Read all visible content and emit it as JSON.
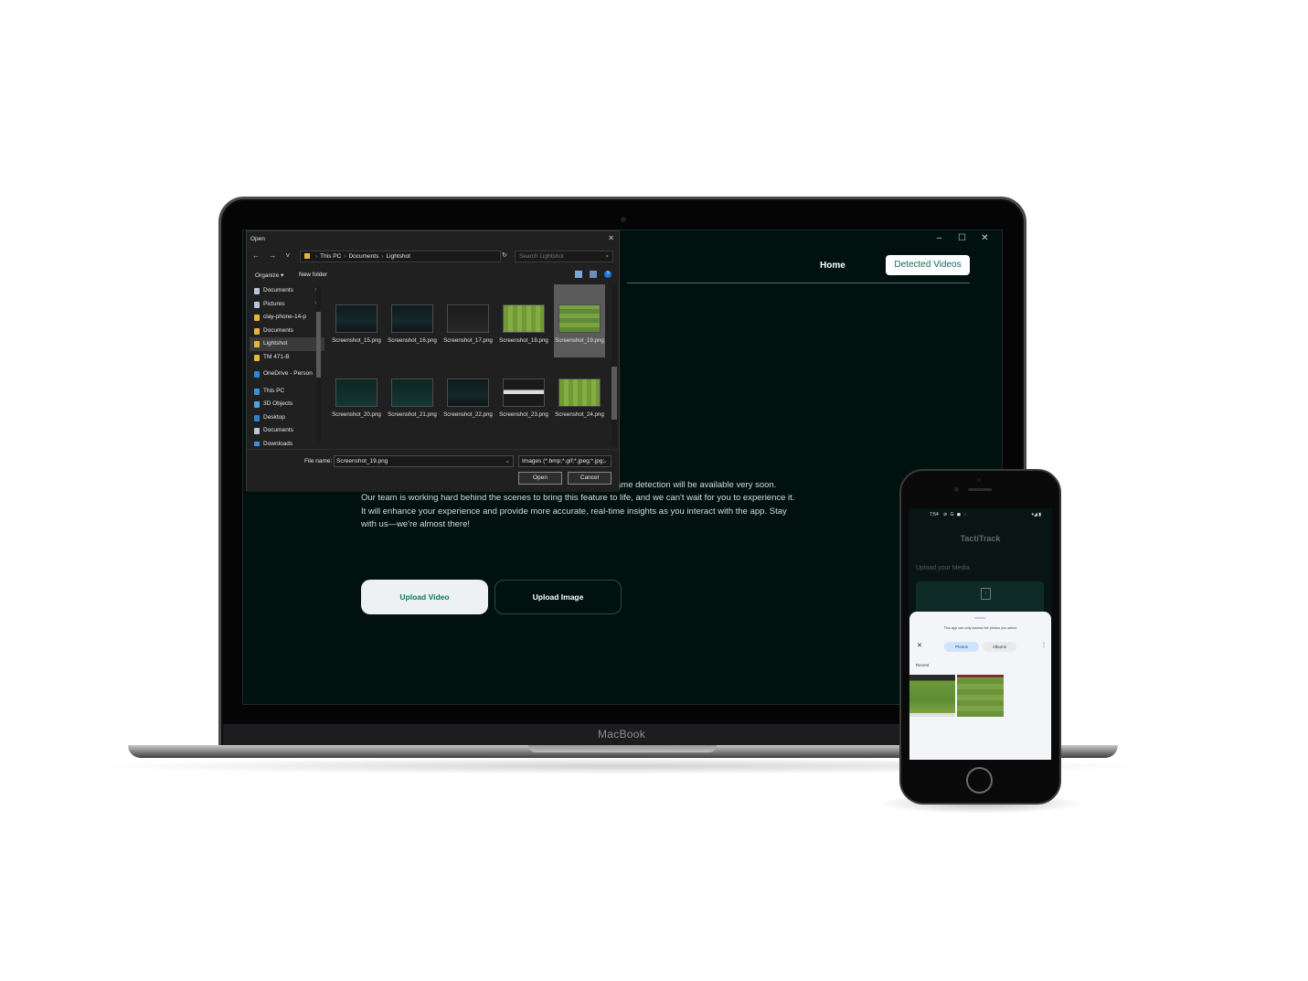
{
  "laptop": {
    "brand": "MacBook"
  },
  "app": {
    "window_controls": [
      "–",
      "☐",
      "✕"
    ],
    "nav": {
      "home": "Home",
      "detected_videos": "Detected Videos"
    },
    "message_first_line": "ame detection will be available very soon.",
    "message_body": "Our team is working hard behind the scenes to bring this feature to life, and we can't wait for you to experience it. It will enhance your experience and provide more accurate, real-time insights as you interact with the app. Stay with us—we're almost there!",
    "upload_video": "Upload Video",
    "upload_image": "Upload Image"
  },
  "dialog": {
    "title": "Open",
    "close": "✕",
    "nav_arrows": "← → ˅ ↑",
    "breadcrumb": [
      "This PC",
      "Documents",
      "Lightshot"
    ],
    "refresh": "↻",
    "search_placeholder": "Search Lightshot",
    "search_icon": "⌕",
    "organize": "Organize ▾",
    "new_folder": "New folder",
    "help": "?",
    "sidebar": [
      {
        "label": "Documents",
        "icon": "document-icon",
        "color": "#b8c6d8",
        "pinned": true
      },
      {
        "label": "Pictures",
        "icon": "picture-icon",
        "color": "#b8c6d8",
        "pinned": true
      },
      {
        "label": "clay-phone-14-p",
        "icon": "folder-icon",
        "color": "#e7b53c",
        "pinned": false
      },
      {
        "label": "Documents",
        "icon": "folder-icon",
        "color": "#e7b53c",
        "pinned": false
      },
      {
        "label": "Lightshot",
        "icon": "folder-icon",
        "color": "#e7b53c",
        "pinned": false,
        "selected": true
      },
      {
        "label": "TM 471-B",
        "icon": "folder-icon",
        "color": "#e7b53c",
        "pinned": false
      },
      {
        "label": "OneDrive - Person",
        "icon": "cloud-icon",
        "color": "#2f86d9",
        "pinned": false,
        "gap_before": true
      },
      {
        "label": "This PC",
        "icon": "computer-icon",
        "color": "#3d8fd8",
        "pinned": false,
        "gap_before": true
      },
      {
        "label": "3D Objects",
        "icon": "cube-icon",
        "color": "#4aa3e6",
        "pinned": false
      },
      {
        "label": "Desktop",
        "icon": "desktop-icon",
        "color": "#2d7fd0",
        "pinned": false
      },
      {
        "label": "Documents",
        "icon": "document-icon",
        "color": "#b8c6d8",
        "pinned": false
      },
      {
        "label": "Downloads",
        "icon": "download-icon",
        "color": "#3d8fd8",
        "pinned": false
      }
    ],
    "files": [
      {
        "name": "Screenshot_15.png",
        "thumb": "dark",
        "selected": false
      },
      {
        "name": "Screenshot_16.png",
        "thumb": "dark",
        "selected": false
      },
      {
        "name": "Screenshot_17.png",
        "thumb": "darkgrey",
        "selected": false
      },
      {
        "name": "Screenshot_18.png",
        "thumb": "pitch",
        "selected": false
      },
      {
        "name": "Screenshot_19.png",
        "thumb": "pitch2",
        "selected": true
      },
      {
        "name": "Screenshot_20.png",
        "thumb": "teal",
        "selected": false
      },
      {
        "name": "Screenshot_21.png",
        "thumb": "teal",
        "selected": false
      },
      {
        "name": "Screenshot_22.png",
        "thumb": "dark",
        "selected": false
      },
      {
        "name": "Screenshot_23.png",
        "thumb": "form",
        "selected": false
      },
      {
        "name": "Screenshot_24.png",
        "thumb": "pitch",
        "selected": false
      }
    ],
    "file_name_label": "File name:",
    "file_name_value": "Screenshot_19.png",
    "file_type": "Images (*.bmp;*.gif;*.jpeg;*.jpg;",
    "open": "Open",
    "cancel": "Cancel"
  },
  "phone": {
    "time": "7:54",
    "status_icons": "⊘ G ◼ ◌",
    "battery": "▾◢ ▮",
    "app_title": "TactiTrack",
    "upload_label": "Upload your Media",
    "upload_icon": "↑",
    "picker": {
      "note": "This app can only access the photos you select",
      "close": "✕",
      "tab_photos": "Photos",
      "tab_albums": "Albums",
      "more": "⋮",
      "recent": "Recent"
    }
  }
}
